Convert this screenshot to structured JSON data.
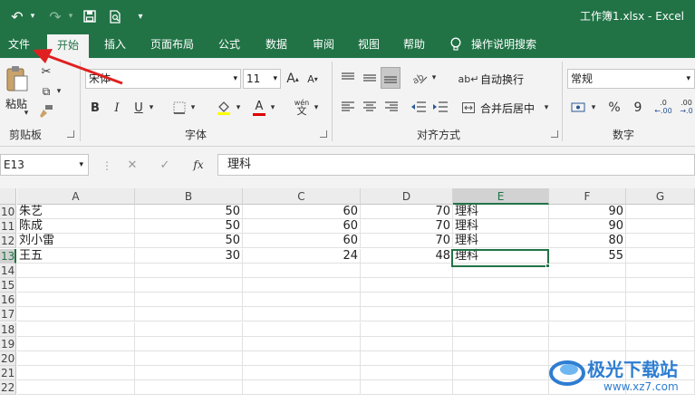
{
  "window": {
    "title": "工作簿1.xlsx  -  Excel"
  },
  "quick_access": {
    "undo_icon": "undo-icon",
    "redo_icon": "redo-icon",
    "save_icon": "save-icon",
    "preview_icon": "print-preview-icon",
    "more_icon": "customize-icon"
  },
  "tabs": [
    "文件",
    "开始",
    "插入",
    "页面布局",
    "公式",
    "数据",
    "审阅",
    "视图",
    "帮助"
  ],
  "tell_me": "操作说明搜索",
  "ribbon": {
    "clipboard": {
      "paste": "粘贴",
      "label": "剪贴板"
    },
    "font": {
      "name": "宋体",
      "size": "11",
      "label": "字体",
      "grow": "A",
      "shrink": "A",
      "bold": "B",
      "italic": "I",
      "underline": "U",
      "phonetic": "wén"
    },
    "alignment": {
      "wrap": "自动换行",
      "merge": "合并后居中",
      "label": "对齐方式"
    },
    "number": {
      "format": "常规",
      "percent": "%",
      "comma": "9",
      "inc_decimal": ".00",
      "dec_decimal": ".0",
      "label": "数字"
    }
  },
  "formula_bar": {
    "name_box": "E13",
    "cancel": "✕",
    "enter": "✓",
    "fx": "fx",
    "content": "理科"
  },
  "columns": [
    "A",
    "B",
    "C",
    "D",
    "E",
    "F",
    "G"
  ],
  "selected_column": "E",
  "rows": [
    {
      "num": "10",
      "cells": [
        "朱艺",
        "50",
        "60",
        "70",
        "理科",
        "90",
        ""
      ]
    },
    {
      "num": "11",
      "cells": [
        "陈成",
        "50",
        "60",
        "70",
        "理科",
        "90",
        ""
      ]
    },
    {
      "num": "12",
      "cells": [
        "刘小雷",
        "50",
        "60",
        "70",
        "理科",
        "80",
        ""
      ]
    },
    {
      "num": "13",
      "cells": [
        "王五",
        "30",
        "24",
        "48",
        "理科",
        "55",
        ""
      ]
    },
    {
      "num": "14",
      "cells": [
        "",
        "",
        "",
        "",
        "",
        "",
        ""
      ]
    },
    {
      "num": "15",
      "cells": [
        "",
        "",
        "",
        "",
        "",
        "",
        ""
      ]
    },
    {
      "num": "16",
      "cells": [
        "",
        "",
        "",
        "",
        "",
        "",
        ""
      ]
    },
    {
      "num": "17",
      "cells": [
        "",
        "",
        "",
        "",
        "",
        "",
        ""
      ]
    },
    {
      "num": "18",
      "cells": [
        "",
        "",
        "",
        "",
        "",
        "",
        ""
      ]
    },
    {
      "num": "19",
      "cells": [
        "",
        "",
        "",
        "",
        "",
        "",
        ""
      ]
    },
    {
      "num": "20",
      "cells": [
        "",
        "",
        "",
        "",
        "",
        "",
        ""
      ]
    },
    {
      "num": "21",
      "cells": [
        "",
        "",
        "",
        "",
        "",
        "",
        ""
      ]
    },
    {
      "num": "22",
      "cells": [
        "",
        "",
        "",
        "",
        "",
        "",
        ""
      ]
    }
  ],
  "selected_row": "13",
  "colors": {
    "accent": "#217346",
    "arrow": "#e02020",
    "highlight": "#ffff00",
    "font_color": "#e00000"
  },
  "watermark": {
    "brand": "极光下载站",
    "url": "www.xz7.com"
  }
}
